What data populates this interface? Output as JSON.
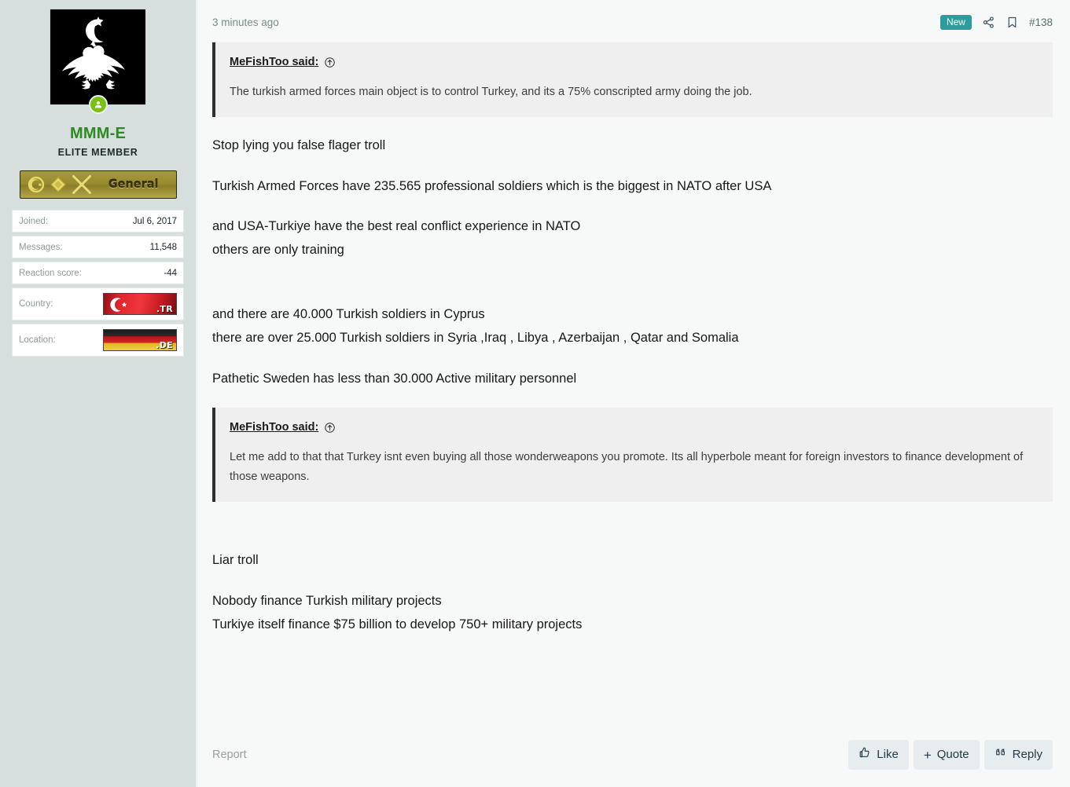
{
  "sidebar": {
    "avatar_icon": "double-headed-eagle-emblem",
    "online_status_icon": "online-user-icon",
    "username": "MMM-E",
    "user_title": "ELITE MEMBER",
    "rank_badge": {
      "label": "General",
      "icons": [
        "star-crescent-icon",
        "diamond-icon",
        "crossed-swords-icon"
      ]
    },
    "stats": [
      {
        "label": "Joined:",
        "value": "Jul 6, 2017",
        "type": "text"
      },
      {
        "label": "Messages:",
        "value": "11,548",
        "type": "text"
      },
      {
        "label": "Reaction score:",
        "value": "-44",
        "type": "text"
      },
      {
        "label": "Country:",
        "value": ".TR",
        "type": "flag",
        "flag": "turkey-flag-icon"
      },
      {
        "label": "Location:",
        "value": ".DE",
        "type": "flag",
        "flag": "germany-flag-icon"
      }
    ]
  },
  "post": {
    "time": "3 minutes ago",
    "new_badge": "New",
    "share_icon": "share-icon",
    "bookmark_icon": "bookmark-icon",
    "post_number": "#138",
    "quote1": {
      "author": "MeFishToo",
      "said_suffix": " said:",
      "jump_icon": "jump-to-post-icon",
      "text": "The turkish armed forces main object is to control Turkey, and its a 75% conscripted army doing the job."
    },
    "paragraphs": [
      "Stop lying you false flager troll",
      "Turkish Armed Forces have 235.565 professional soldiers which is the biggest in NATO after USA",
      "and USA-Turkiye have the best real conflict experience in NATO",
      "others are only training",
      "and there are 40.000 Turkish soldiers in Cyprus",
      "there are over 25.000 Turkish soldiers in Syria ,Iraq , Libya , Azerbaijan , Qatar and Somalia",
      "Pathetic Sweden has less than 30.000 Active military personnel"
    ],
    "quote2": {
      "author": "MeFishToo",
      "said_suffix": " said:",
      "jump_icon": "jump-to-post-icon",
      "text": "Let me add to that that Turkey isnt even buying all those wonderweapons you promote. Its all hyperbole meant for foreign investors to finance development of those weapons."
    },
    "paragraphs_after": [
      "Liar troll",
      "Nobody finance Turkish military projects",
      "Turkiye itself finance $75 billion to develop 750+ military projects"
    ],
    "footer": {
      "report": "Report",
      "like": "Like",
      "quote": "Quote",
      "quote_plus": "+",
      "reply": "Reply",
      "like_icon": "thumbs-up-icon",
      "reply_icon": "quote-marks-icon"
    }
  },
  "colors": {
    "sidebar_bg": "#d6dfde",
    "main_bg": "#f7f8f8",
    "username": "#2f8a22",
    "new_badge": "#2a9d9c",
    "quote_bg": "#efefef",
    "button_bg": "#e7ecee"
  }
}
